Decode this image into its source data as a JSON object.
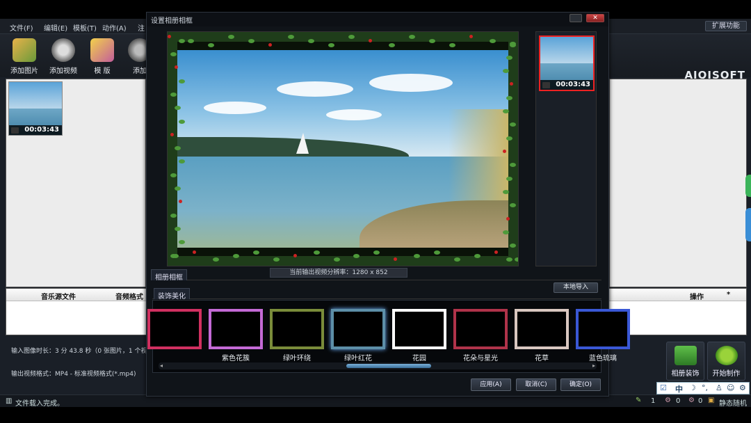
{
  "menu": [
    "文件(F)",
    "编辑(E)",
    "模板(T)",
    "动作(A)",
    "注"
  ],
  "ext_button": "扩展功能",
  "toolbar": [
    "添加图片",
    "添加视频",
    "模 版",
    "添加"
  ],
  "brand": "AIQISOFT",
  "left_thumb_duration": "00:03:43",
  "music_headers": {
    "source": "音乐源文件",
    "format": "音频格式",
    "ops": "操作",
    "star": "*"
  },
  "info_lines": {
    "duration": "输入图像时长：3 分 43.8 秒（0 张图片，1 个视",
    "format": "输出视频格式：MP4 - 标准视频格式(*.mp4)"
  },
  "big_buttons": {
    "album": "相册装饰",
    "start": "开始制作"
  },
  "status": {
    "left": "文件载入完成。",
    "count1": "1",
    "count2": "0",
    "count3": "0",
    "mode": "静态随机"
  },
  "ime": {
    "label": "中"
  },
  "dialog": {
    "title": "设置相册相框",
    "side_thumb_duration": "00:03:43",
    "tab_frame": "相册相框",
    "resolution": "当前输出视频分辨率：1280 x 852",
    "import": "本地导入",
    "tab_decor": "装饰美化",
    "frames": [
      {
        "name": "",
        "color": "#d03060"
      },
      {
        "name": "紫色花簇",
        "color": "#c46ad6"
      },
      {
        "name": "绿叶环绕",
        "color": "#7a8c3a"
      },
      {
        "name": "绿叶红花",
        "color": "#5d8fa8"
      },
      {
        "name": "花园",
        "color": "#ffffff"
      },
      {
        "name": "花朵与星光",
        "color": "#b0334a"
      },
      {
        "name": "花草",
        "color": "#d9c7c0"
      },
      {
        "name": "蓝色琉璃",
        "color": "#3a58d6"
      }
    ],
    "buttons": {
      "apply": "应用(A)",
      "cancel": "取消(C)",
      "ok": "确定(O)"
    }
  }
}
